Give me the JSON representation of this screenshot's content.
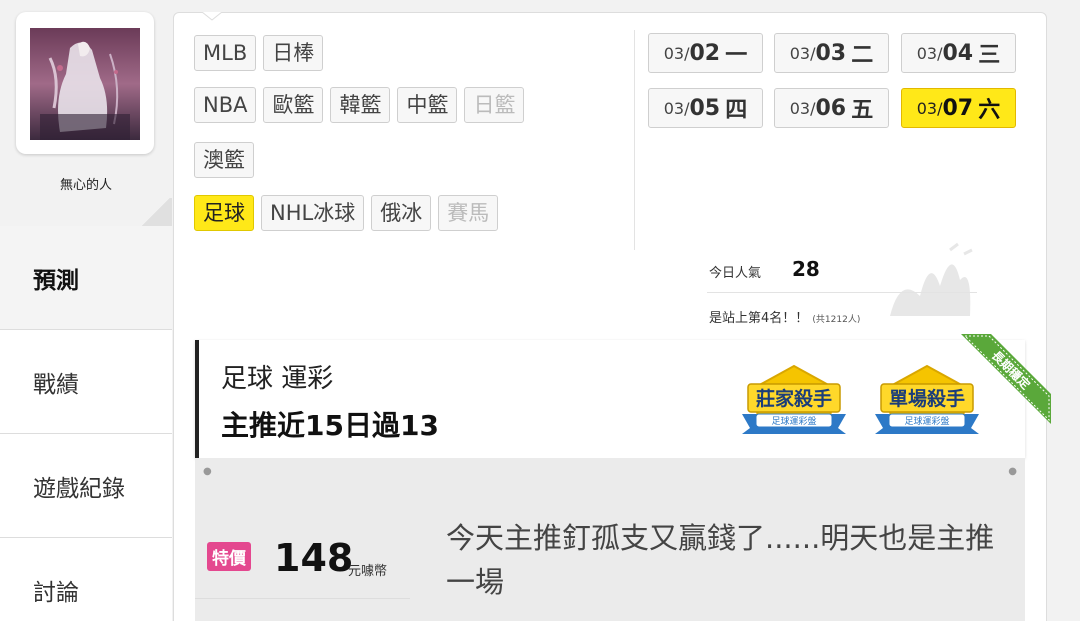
{
  "user": {
    "name": "無心的人"
  },
  "nav": {
    "items": [
      {
        "label": "預測"
      },
      {
        "label": "戰績"
      },
      {
        "label": "遊戲紀錄"
      },
      {
        "label": "討論"
      }
    ]
  },
  "sports": {
    "row1": [
      {
        "label": "MLB"
      },
      {
        "label": "日棒"
      }
    ],
    "row2": [
      {
        "label": "NBA"
      },
      {
        "label": "歐籃"
      },
      {
        "label": "韓籃"
      },
      {
        "label": "中籃"
      },
      {
        "label": "日籃"
      }
    ],
    "row3": [
      {
        "label": "澳籃"
      }
    ],
    "row4": [
      {
        "label": "足球"
      },
      {
        "label": "NHL冰球"
      },
      {
        "label": "俄冰"
      },
      {
        "label": "賽馬"
      }
    ]
  },
  "dates": [
    {
      "month": "03/",
      "day": "02",
      "weekday": "一"
    },
    {
      "month": "03/",
      "day": "03",
      "weekday": "二"
    },
    {
      "month": "03/",
      "day": "04",
      "weekday": "三"
    },
    {
      "month": "03/",
      "day": "05",
      "weekday": "四"
    },
    {
      "month": "03/",
      "day": "06",
      "weekday": "五"
    },
    {
      "month": "03/",
      "day": "07",
      "weekday": "六"
    }
  ],
  "popularity": {
    "label": "今日人氣",
    "value": "28"
  },
  "rank": {
    "text": "是站上第4名！！",
    "total": "(共1212人)"
  },
  "header": {
    "sport_type": "足球 運彩",
    "record": "主推近15日過13",
    "badges": [
      {
        "title": "莊家殺手",
        "subtitle": "足球運彩盤"
      },
      {
        "title": "單場殺手",
        "subtitle": "足球運彩盤"
      }
    ],
    "ribbon": "長期穩定"
  },
  "offer": {
    "tag": "特價",
    "price": "148",
    "unit": "元噱幣",
    "description": "今天主推釘孤支又贏錢了......明天也是主推一場"
  },
  "colors": {
    "selected": "#ffe818",
    "price_tag": "#e4488f",
    "badge_gold": "#f5c400",
    "badge_blue": "#2d79c7"
  }
}
